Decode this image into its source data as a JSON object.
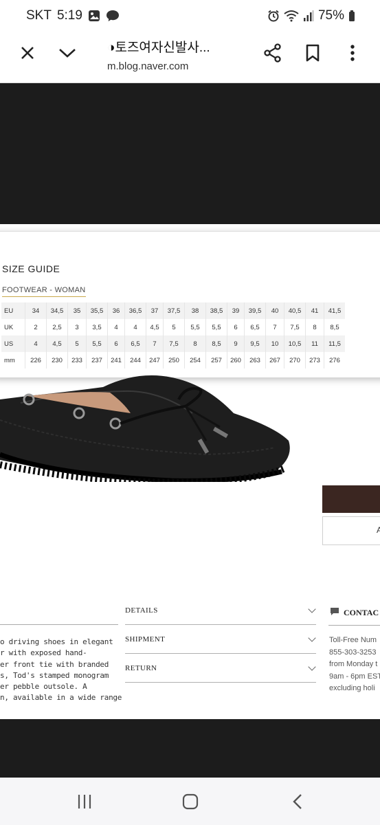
{
  "status": {
    "carrier": "SKT",
    "time": "5:19",
    "battery": "75%",
    "icons": [
      "gallery-icon",
      "messenger-icon",
      "alarm-icon",
      "wifi-icon",
      "signal-icon",
      "battery-icon"
    ]
  },
  "browser": {
    "title": "◑토즈여자신발사...",
    "url": "m.blog.naver.com",
    "icons": [
      "close-icon",
      "chevron-down-icon",
      "share-icon",
      "bookmark-icon",
      "more-vert-icon"
    ]
  },
  "image": {
    "size_guide": {
      "title": "SIZE GUIDE",
      "subtitle": "FOOTWEAR - WOMAN",
      "rows": [
        {
          "label": "EU",
          "values": [
            "34",
            "34,5",
            "35",
            "35,5",
            "36",
            "36,5",
            "37",
            "37,5",
            "38",
            "38,5",
            "39",
            "39,5",
            "40",
            "40,5",
            "41",
            "41,5"
          ]
        },
        {
          "label": "UK",
          "values": [
            "2",
            "2,5",
            "3",
            "3,5",
            "4",
            "4",
            "4,5",
            "5",
            "5,5",
            "5,5",
            "6",
            "6,5",
            "7",
            "7,5",
            "8",
            "8,5"
          ]
        },
        {
          "label": "US",
          "values": [
            "4",
            "4,5",
            "5",
            "5,5",
            "6",
            "6,5",
            "7",
            "7,5",
            "8",
            "8,5",
            "9",
            "9,5",
            "10",
            "10,5",
            "11",
            "11,5"
          ]
        },
        {
          "label": "mm",
          "values": [
            "226",
            "230",
            "233",
            "237",
            "241",
            "244",
            "247",
            "250",
            "254",
            "257",
            "260",
            "263",
            "267",
            "270",
            "273",
            "276"
          ]
        }
      ]
    },
    "side_button_text": "A",
    "description": [
      "o driving shoes in elegant",
      "r with exposed hand-",
      "er front tie with branded",
      "s, Tod's stamped monogram",
      "er pebble outsole. A",
      "n, available in a wide range"
    ],
    "accordion": [
      "DETAILS",
      "SHIPMENT",
      "RETURN"
    ],
    "contact": {
      "title": "CONTAC",
      "lines": [
        "Toll-Free Num",
        "855-303-3253",
        "from Monday t",
        "9am - 6pm EST",
        "excluding holi"
      ]
    }
  },
  "navbar": {
    "icons": [
      "recent-apps-icon",
      "home-icon",
      "back-icon"
    ]
  },
  "colors": {
    "background": "#1c1c1c",
    "accent_underline": "#c9a94a",
    "brown_button": "#3b2621"
  }
}
